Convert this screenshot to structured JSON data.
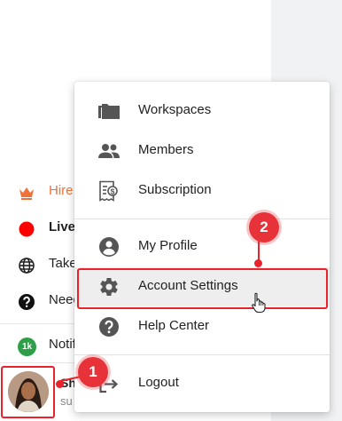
{
  "sidebar": {
    "items": [
      {
        "label": "Hire",
        "color": "#f0713a",
        "icon": "crown-icon"
      },
      {
        "label": "Live",
        "bold": true,
        "icon": "red-dot-icon"
      },
      {
        "label": "Take",
        "icon": "globe-icon"
      },
      {
        "label": "Need",
        "icon": "help-circle-icon"
      },
      {
        "label": "Notif",
        "icon": "notification-badge-icon",
        "badge": "1k"
      }
    ],
    "user": {
      "name": "Sh",
      "email": "su"
    }
  },
  "menu": {
    "items": [
      {
        "label": "Workspaces",
        "icon": "folder-icon"
      },
      {
        "label": "Members",
        "icon": "people-icon"
      },
      {
        "label": "Subscription",
        "icon": "receipt-dollar-icon"
      },
      {
        "label": "My Profile",
        "icon": "account-circle-icon"
      },
      {
        "label": "Account Settings",
        "icon": "gear-icon"
      },
      {
        "label": "Help Center",
        "icon": "help-circle-icon"
      },
      {
        "label": "Logout",
        "icon": "logout-icon"
      }
    ]
  },
  "annotations": {
    "step1": "1",
    "step2": "2"
  },
  "colors": {
    "accent_red": "#e8232b",
    "hire_orange": "#f0713a",
    "notif_green": "#2e9e48"
  }
}
